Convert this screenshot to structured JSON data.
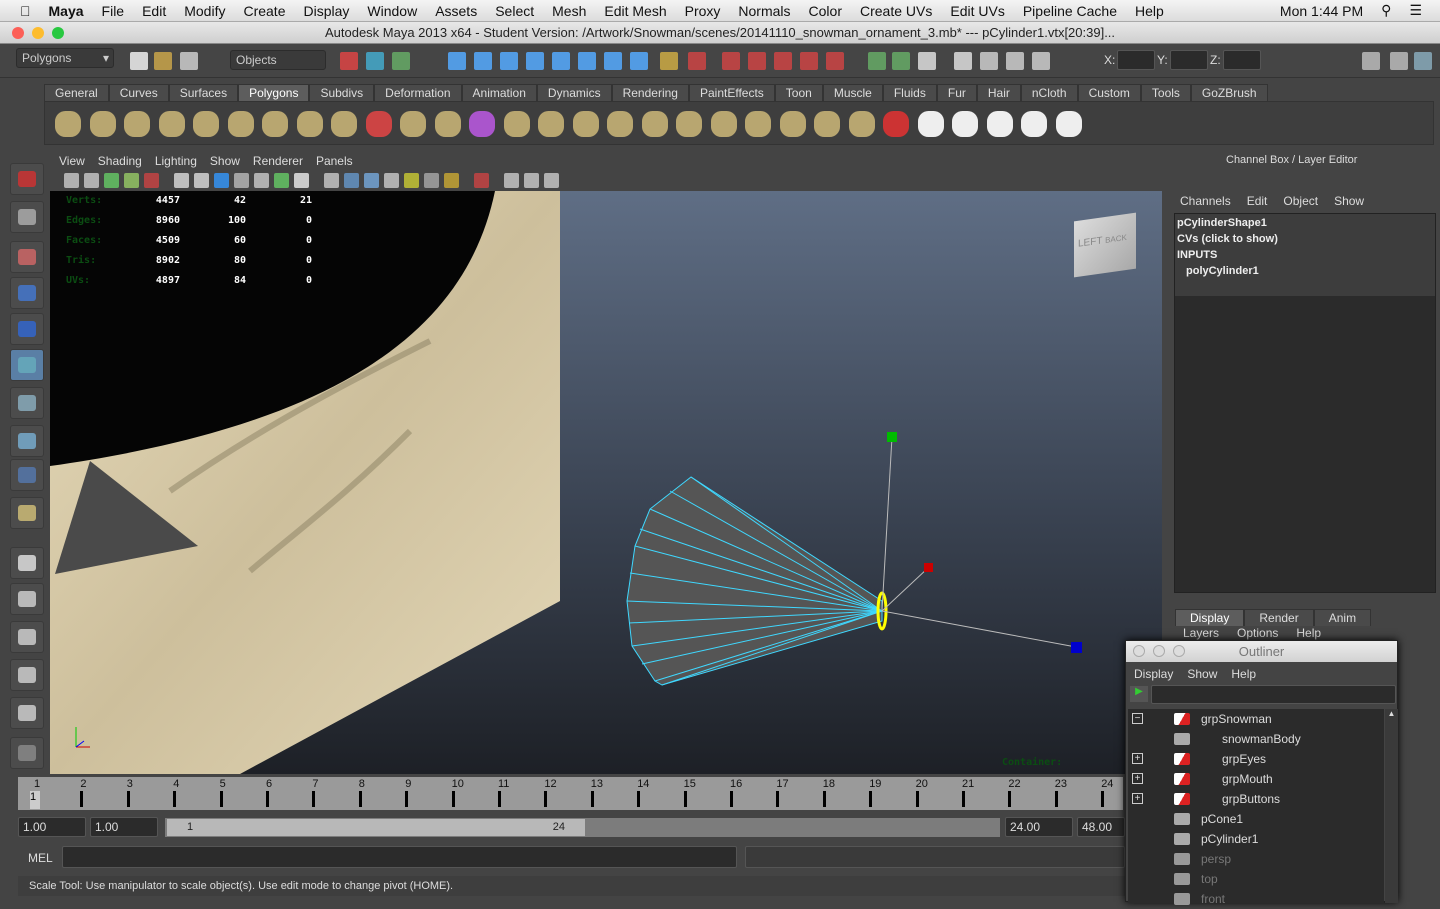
{
  "menubar": {
    "apple": "",
    "items": [
      "Maya",
      "File",
      "Edit",
      "Modify",
      "Create",
      "Display",
      "Window",
      "Assets",
      "Select",
      "Mesh",
      "Edit Mesh",
      "Proxy",
      "Normals",
      "Color",
      "Create UVs",
      "Edit UVs",
      "Pipeline Cache",
      "Help"
    ],
    "clock": "Mon 1:44 PM"
  },
  "window_title": "Autodesk Maya 2013 x64 - Student Version: /Artwork/Snowman/scenes/20141110_snowman_ornament_3.mb*  ---  pCylinder1.vtx[20:39]...",
  "status_line": {
    "menu_set": "Polygons",
    "selection_mode": "Objects",
    "x_label": "X:",
    "y_label": "Y:",
    "z_label": "Z:",
    "x": "",
    "y": "",
    "z": ""
  },
  "shelf": {
    "tabs": [
      "General",
      "Curves",
      "Surfaces",
      "Polygons",
      "Subdivs",
      "Deformation",
      "Animation",
      "Dynamics",
      "Rendering",
      "PaintEffects",
      "Toon",
      "Muscle",
      "Fluids",
      "Fur",
      "Hair",
      "nCloth",
      "Custom",
      "Tools",
      "GoZBrush"
    ],
    "active": "Polygons"
  },
  "viewport": {
    "menu": [
      "View",
      "Shading",
      "Lighting",
      "Show",
      "Renderer",
      "Panels"
    ],
    "hud": {
      "labels": [
        "Verts:",
        "Edges:",
        "Faces:",
        "Tris:",
        "UVs:"
      ],
      "rows": [
        [
          "4457",
          "42",
          "21"
        ],
        [
          "8960",
          "100",
          "0"
        ],
        [
          "4509",
          "60",
          "0"
        ],
        [
          "8902",
          "80",
          "0"
        ],
        [
          "4897",
          "84",
          "0"
        ]
      ]
    },
    "viewcube": {
      "left": "LEFT",
      "back": "BACK"
    },
    "container_label": "Container:"
  },
  "channel_box": {
    "title": "Channel Box / Layer Editor",
    "menu": [
      "Channels",
      "Edit",
      "Object",
      "Show"
    ],
    "lines": [
      "pCylinderShape1",
      "CVs (click to show)",
      "INPUTS",
      "polyCylinder1"
    ]
  },
  "layer_editor": {
    "tabs": [
      "Display",
      "Render",
      "Anim"
    ],
    "active": "Display",
    "menu": [
      "Layers",
      "Options",
      "Help"
    ]
  },
  "time_slider": {
    "frames": [
      "1",
      "2",
      "3",
      "4",
      "5",
      "6",
      "7",
      "8",
      "9",
      "10",
      "11",
      "12",
      "13",
      "14",
      "15",
      "16",
      "17",
      "18",
      "19",
      "20",
      "21",
      "22",
      "23",
      "24"
    ],
    "current": "1"
  },
  "range_slider": {
    "start": "1.00",
    "inner_start": "1.00",
    "range_start": "1",
    "range_end": "24",
    "inner_end": "24.00",
    "end": "48.00"
  },
  "command_line": {
    "label": "MEL",
    "value": ""
  },
  "help_line": "Scale Tool: Use manipulator to scale object(s). Use edit mode to change pivot (HOME).",
  "outliner": {
    "title": "Outliner",
    "menu": [
      "Display",
      "Show",
      "Help"
    ],
    "filter": "",
    "items": [
      {
        "name": "grpSnowman",
        "type": "group",
        "expand": "−",
        "depth": 0
      },
      {
        "name": "snowmanBody",
        "type": "mesh",
        "expand": "",
        "depth": 1
      },
      {
        "name": "grpEyes",
        "type": "group",
        "expand": "+",
        "depth": 1
      },
      {
        "name": "grpMouth",
        "type": "group",
        "expand": "+",
        "depth": 1
      },
      {
        "name": "grpButtons",
        "type": "group",
        "expand": "+",
        "depth": 1
      },
      {
        "name": "pCone1",
        "type": "mesh",
        "expand": "",
        "depth": 0
      },
      {
        "name": "pCylinder1",
        "type": "mesh",
        "expand": "",
        "depth": 0
      },
      {
        "name": "persp",
        "type": "camera",
        "expand": "",
        "depth": 0
      },
      {
        "name": "top",
        "type": "camera",
        "expand": "",
        "depth": 0
      },
      {
        "name": "front",
        "type": "camera",
        "expand": "",
        "depth": 0
      }
    ]
  },
  "colors": {
    "hud_label": "#0b4d12",
    "wire": "#3fd8ff",
    "selection": "#ffff00",
    "manip_x": "#cc0000",
    "manip_y": "#00bb00",
    "manip_z": "#0000cc"
  }
}
